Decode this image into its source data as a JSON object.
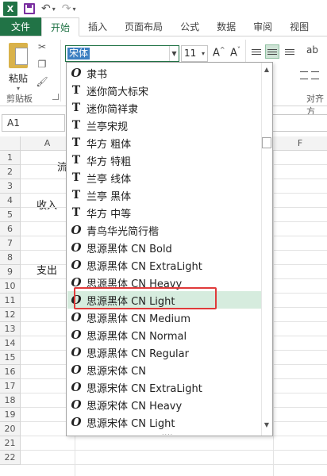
{
  "app": {
    "logo": "X"
  },
  "quick_access": {
    "save": "save-icon",
    "undo": "↶",
    "undo_dd": "▾",
    "redo": "↷",
    "redo_dd": "▾"
  },
  "tabs": [
    {
      "label": "文件"
    },
    {
      "label": "开始"
    },
    {
      "label": "插入"
    },
    {
      "label": "页面布局"
    },
    {
      "label": "公式"
    },
    {
      "label": "数据"
    },
    {
      "label": "审阅"
    },
    {
      "label": "视图"
    }
  ],
  "ribbon": {
    "paste_label": "粘贴",
    "clipboard_label": "剪贴板",
    "font_value": "宋体",
    "size_value": "11",
    "grow": "A",
    "shrink": "A",
    "align_label": "对齐方"
  },
  "formula": {
    "namebox": "A1"
  },
  "grid": {
    "columns": [
      "A",
      "F"
    ],
    "rows": [
      "1",
      "2",
      "3",
      "4",
      "5",
      "6",
      "7",
      "8",
      "9",
      "10",
      "11",
      "12",
      "13",
      "14",
      "15",
      "16",
      "17",
      "18",
      "19",
      "20",
      "21",
      "22"
    ],
    "cells": {
      "b1": "流",
      "a4": "收入",
      "a8": "支出"
    }
  },
  "fontlist": {
    "items": [
      {
        "label": "隶书",
        "icon": "o"
      },
      {
        "label": "迷你简大标宋",
        "icon": "t"
      },
      {
        "label": "迷你简祥隶",
        "icon": "t"
      },
      {
        "label": "兰亭宋规",
        "icon": "t"
      },
      {
        "label": "华方 粗体",
        "icon": "t"
      },
      {
        "label": "华方 特粗",
        "icon": "t"
      },
      {
        "label": "兰亭 线体",
        "icon": "t"
      },
      {
        "label": "兰亭 黑体",
        "icon": "t"
      },
      {
        "label": "华方 中等",
        "icon": "t"
      },
      {
        "label": "青鸟华光简行楷",
        "icon": "o"
      },
      {
        "label": "思源黑体 CN Bold",
        "icon": "o"
      },
      {
        "label": "思源黑体 CN ExtraLight",
        "icon": "o"
      },
      {
        "label": "思源黑体 CN Heavy",
        "icon": "o"
      },
      {
        "label": "思源黑体 CN Light",
        "icon": "o"
      },
      {
        "label": "思源黑体 CN Medium",
        "icon": "o"
      },
      {
        "label": "思源黑体 CN Normal",
        "icon": "o"
      },
      {
        "label": "思源黑体 CN Regular",
        "icon": "o"
      },
      {
        "label": "思源宋体 CN",
        "icon": "o"
      },
      {
        "label": "思源宋体 CN ExtraLight",
        "icon": "o"
      },
      {
        "label": "思源宋体 CN Heavy",
        "icon": "o"
      },
      {
        "label": "思源宋体 CN Light",
        "icon": "o"
      }
    ],
    "highlighted_index": 13,
    "scroll_up": "▲",
    "scroll_down": "▼",
    "grip": "....",
    "highlight_color": "#d6ecde",
    "callout_color": "#e03a3a"
  }
}
